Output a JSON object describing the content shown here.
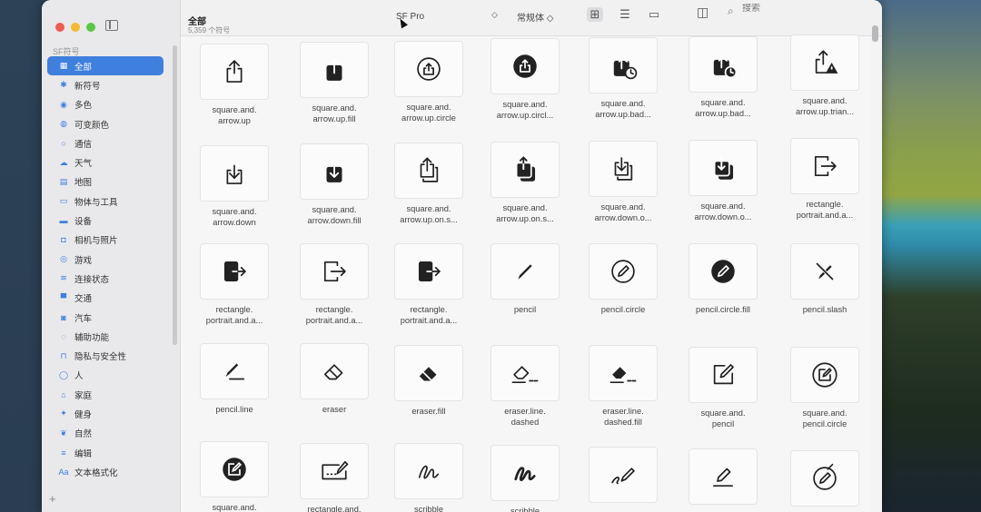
{
  "sidebar": {
    "section_label": "SF符号",
    "add_label": "+",
    "items": [
      {
        "label": "全部",
        "icon": "grid-icon",
        "glyph": "▦",
        "active": true
      },
      {
        "label": "新符号",
        "icon": "sparkle-icon",
        "glyph": "✱"
      },
      {
        "label": "多色",
        "icon": "palette-icon",
        "glyph": "◉"
      },
      {
        "label": "可变颜色",
        "icon": "variable-color-icon",
        "glyph": "◍"
      },
      {
        "label": "通信",
        "icon": "message-icon",
        "glyph": "○"
      },
      {
        "label": "天气",
        "icon": "cloud-icon",
        "glyph": "☁"
      },
      {
        "label": "地图",
        "icon": "map-icon",
        "glyph": "▤"
      },
      {
        "label": "物体与工具",
        "icon": "folder-icon",
        "glyph": "▭"
      },
      {
        "label": "设备",
        "icon": "display-icon",
        "glyph": "▬"
      },
      {
        "label": "相机与照片",
        "icon": "camera-icon",
        "glyph": "◘"
      },
      {
        "label": "游戏",
        "icon": "gamecontroller-icon",
        "glyph": "◎"
      },
      {
        "label": "连接状态",
        "icon": "antenna-icon",
        "glyph": "≋"
      },
      {
        "label": "交通",
        "icon": "car-icon",
        "glyph": "▀"
      },
      {
        "label": "汽车",
        "icon": "steering-wheel-icon",
        "glyph": "◙"
      },
      {
        "label": "辅助功能",
        "icon": "accessibility-icon",
        "glyph": "◌"
      },
      {
        "label": "隐私与安全性",
        "icon": "lock-icon",
        "glyph": "⊓"
      },
      {
        "label": "人",
        "icon": "person-icon",
        "glyph": "◯"
      },
      {
        "label": "家庭",
        "icon": "house-icon",
        "glyph": "⌂"
      },
      {
        "label": "健身",
        "icon": "figure-run-icon",
        "glyph": "✦"
      },
      {
        "label": "自然",
        "icon": "leaf-icon",
        "glyph": "❦"
      },
      {
        "label": "编辑",
        "icon": "lines-icon",
        "glyph": "≡"
      },
      {
        "label": "文本格式化",
        "icon": "text-format-icon",
        "glyph": "Aa"
      }
    ]
  },
  "toolbar": {
    "title": "全部",
    "subtitle": "5,359 个符号",
    "font": "SF Pro",
    "font_arrows": "◇",
    "weight": "常规体 ◇",
    "search_placeholder": "搜索",
    "grid_icon": "⊞",
    "list_icon": "☰",
    "gallery_icon": "▭",
    "inspector_icon": "◫",
    "search_icon": "⌕"
  },
  "symbols": [
    {
      "label": "square.and.\narrow.up",
      "icon": "up"
    },
    {
      "label": "square.and.\narrow.up.fill",
      "icon": "up-fill"
    },
    {
      "label": "square.and.\narrow.up.circle",
      "icon": "up-circle"
    },
    {
      "label": "square.and.\narrow.up.circl...",
      "icon": "up-circle-fill"
    },
    {
      "label": "square.and.\narrow.up.bad...",
      "icon": "up-badge"
    },
    {
      "label": "square.and.\narrow.up.bad...",
      "icon": "up-badge-fill"
    },
    {
      "label": "square.and.\narrow.up.trian...",
      "icon": "up-triangle"
    },
    {
      "label": "square.and.\narrow.down",
      "icon": "down"
    },
    {
      "label": "square.and.\narrow.down.fill",
      "icon": "down-fill"
    },
    {
      "label": "square.and.\narrow.up.on.s...",
      "icon": "up-on-square"
    },
    {
      "label": "square.and.\narrow.up.on.s...",
      "icon": "up-on-square-fill"
    },
    {
      "label": "square.and.\narrow.down.o...",
      "icon": "down-on-square"
    },
    {
      "label": "square.and.\narrow.down.o...",
      "icon": "down-on-square-fill"
    },
    {
      "label": "rectangle.\nportrait.and.a...",
      "icon": "portrait-arrow"
    },
    {
      "label": "rectangle.\nportrait.and.a...",
      "icon": "portrait-arrow-fill"
    },
    {
      "label": "rectangle.\nportrait.and.a...",
      "icon": "portrait-arrow"
    },
    {
      "label": "rectangle.\nportrait.and.a...",
      "icon": "portrait-arrow-fill"
    },
    {
      "label": "pencil",
      "icon": "pencil"
    },
    {
      "label": "pencil.circle",
      "icon": "pencil-circle"
    },
    {
      "label": "pencil.circle.fill",
      "icon": "pencil-circle-fill"
    },
    {
      "label": "pencil.slash",
      "icon": "pencil-slash"
    },
    {
      "label": "pencil.line",
      "icon": "pencil-line"
    },
    {
      "label": "eraser",
      "icon": "eraser"
    },
    {
      "label": "eraser.fill",
      "icon": "eraser-fill"
    },
    {
      "label": "eraser.line.\ndashed",
      "icon": "eraser-dashed"
    },
    {
      "label": "eraser.line.\ndashed.fill",
      "icon": "eraser-dashed-fill"
    },
    {
      "label": "square.and.\npencil",
      "icon": "square-pencil"
    },
    {
      "label": "square.and.\npencil.circle",
      "icon": "square-pencil-circle"
    },
    {
      "label": "square.and.",
      "icon": "square-pencil-circle-fill"
    },
    {
      "label": "rectangle.and.",
      "icon": "rect-pencil"
    },
    {
      "label": "scribble",
      "icon": "scribble"
    },
    {
      "label": "scribble",
      "icon": "scribble-bold"
    },
    {
      "label": "",
      "icon": "pencil-scribble"
    },
    {
      "label": "",
      "icon": "pencil-underline"
    },
    {
      "label": "",
      "icon": "pencil-circle-slash"
    }
  ]
}
